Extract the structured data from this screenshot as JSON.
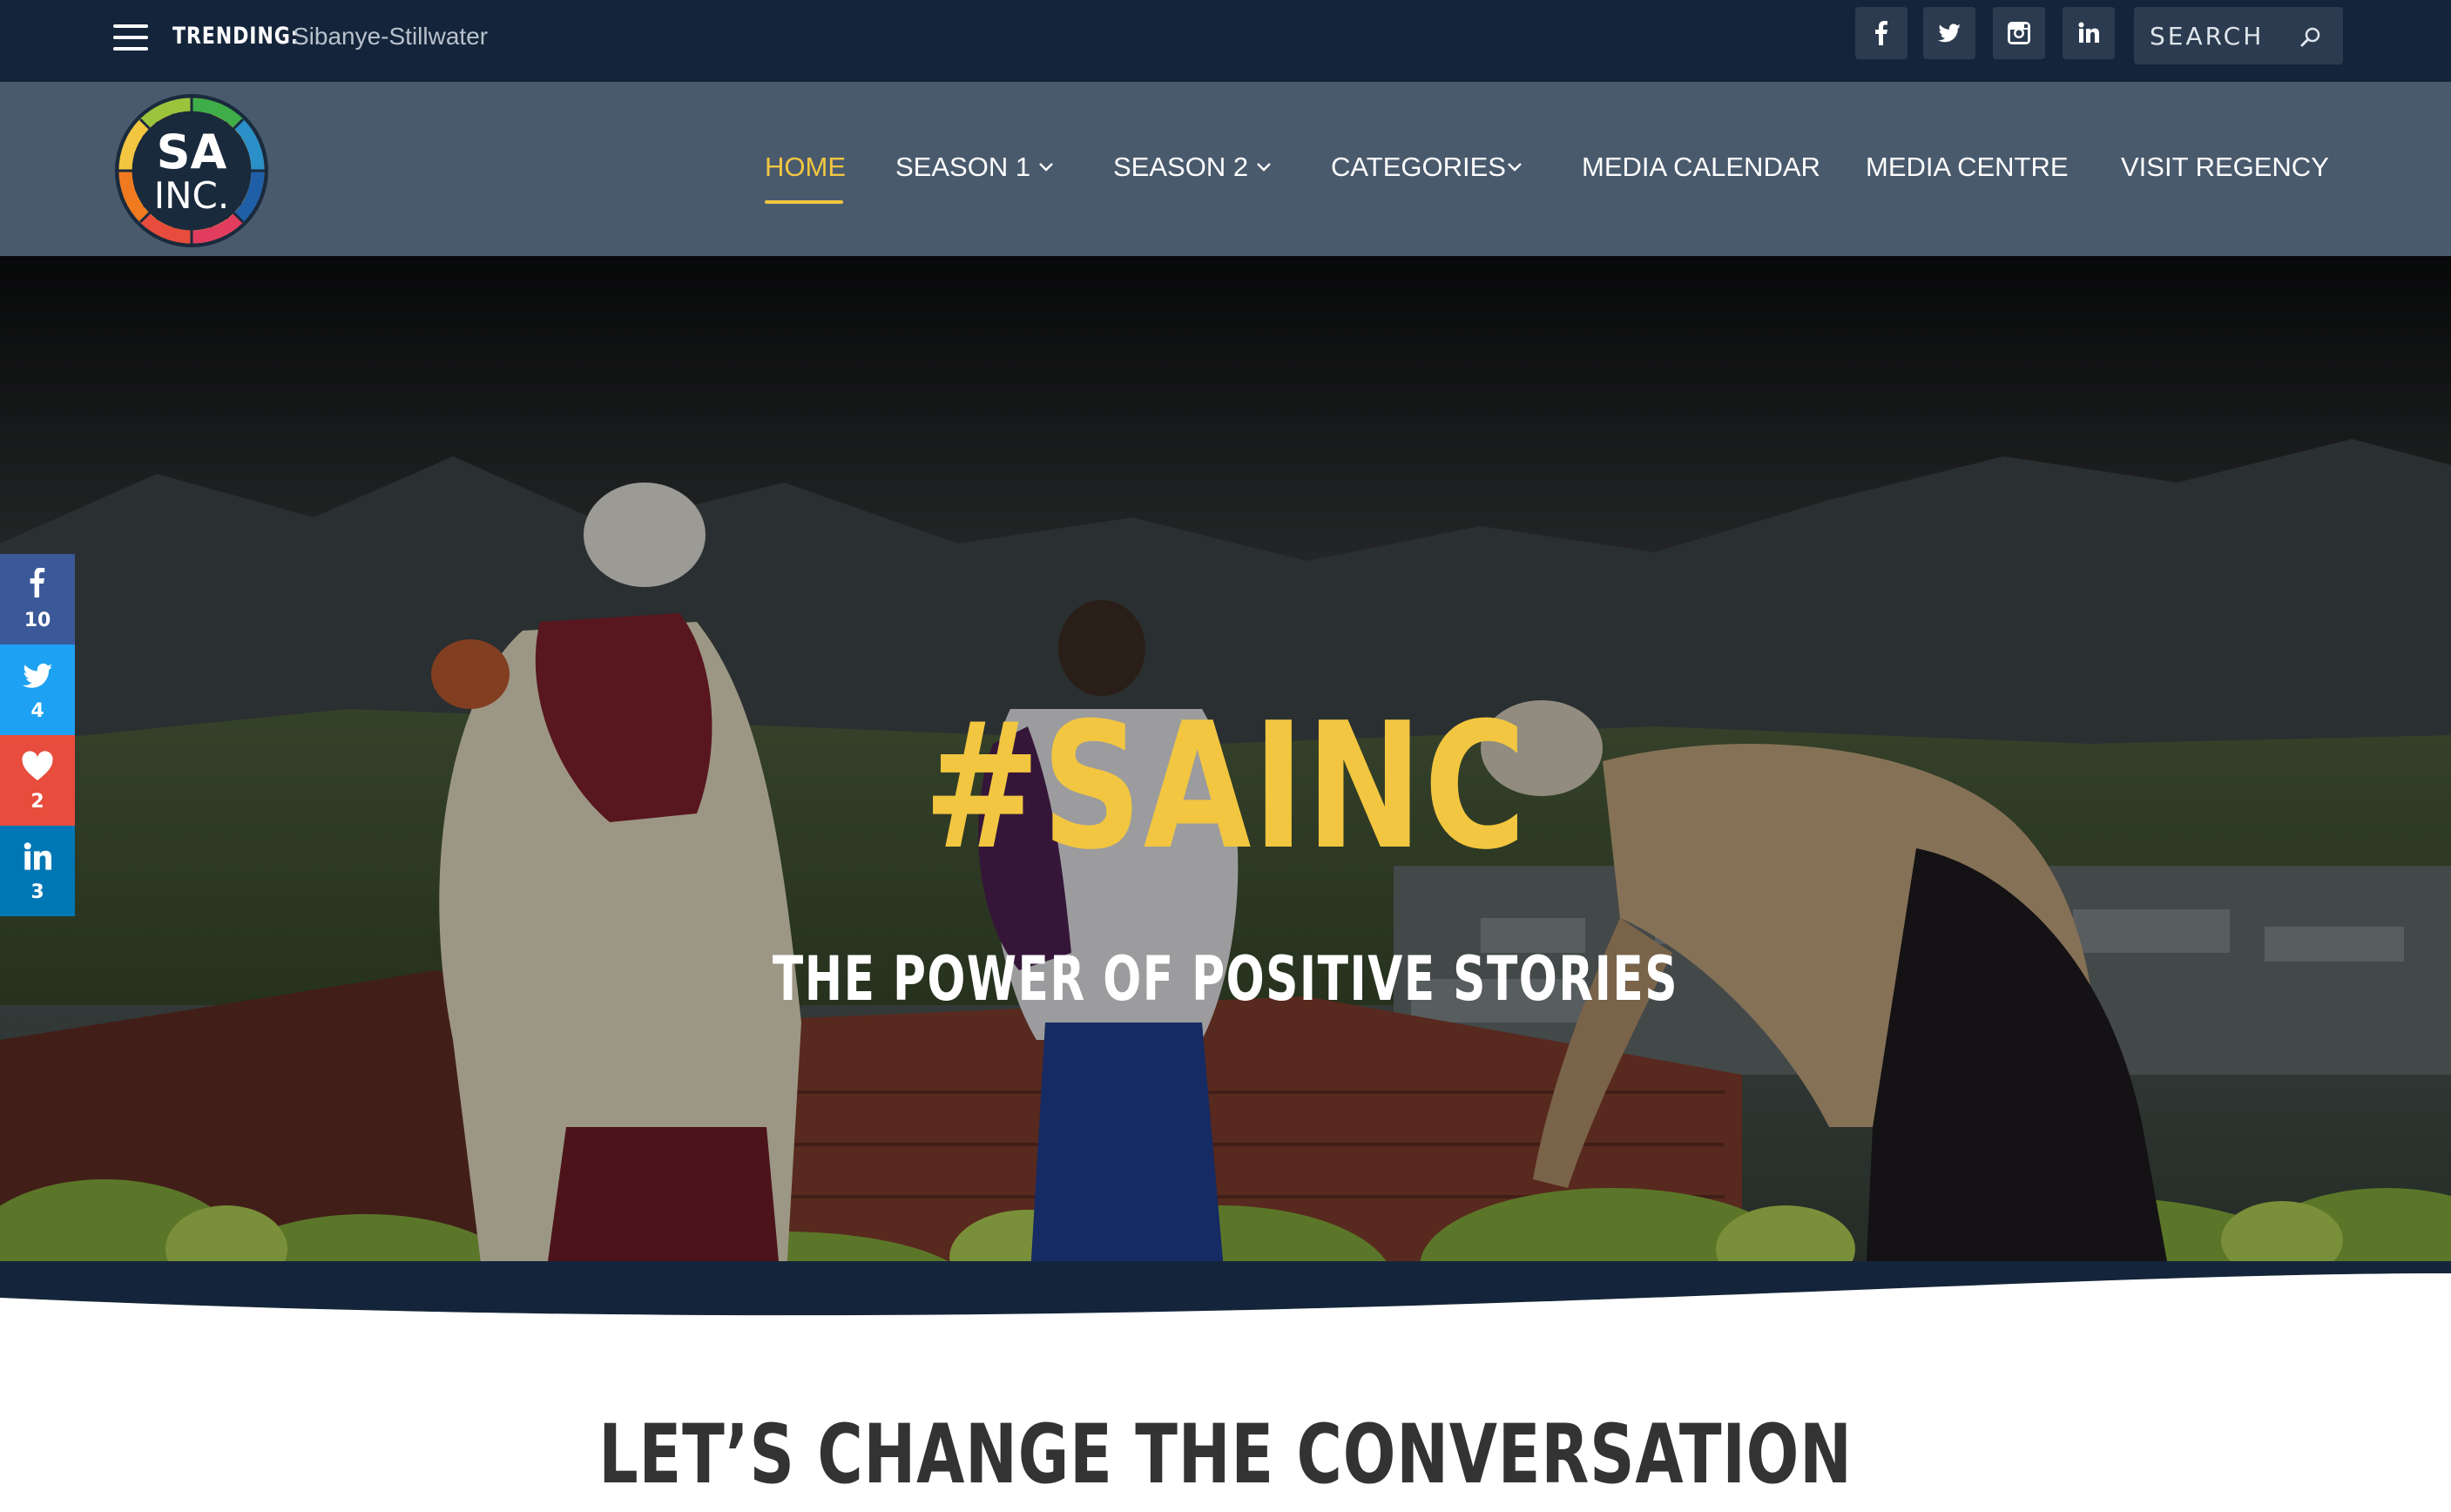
{
  "topbar": {
    "trending_label": "TRENDING:",
    "trending_value": "Sibanye-Stillwater",
    "social": [
      "facebook",
      "twitter",
      "instagram",
      "linkedin"
    ],
    "search_placeholder": "SEARCH"
  },
  "logo": {
    "line1": "SA",
    "line2": "INC."
  },
  "nav": {
    "items": [
      {
        "label": "HOME",
        "active": true
      },
      {
        "label": "SEASON 1",
        "has_dropdown": true
      },
      {
        "label": "SEASON 2",
        "has_dropdown": true
      },
      {
        "label": "CATEGORIES",
        "has_dropdown": true
      },
      {
        "label": "MEDIA CALENDAR"
      },
      {
        "label": "MEDIA CENTRE"
      },
      {
        "label": "VISIT REGENCY"
      }
    ]
  },
  "hero": {
    "title": "#SAINC",
    "subtitle": "THE POWER OF POSITIVE STORIES"
  },
  "share": [
    {
      "network": "facebook",
      "count": "10",
      "color": "#3b5998"
    },
    {
      "network": "twitter",
      "count": "4",
      "color": "#1da1f2"
    },
    {
      "network": "love",
      "count": "2",
      "color": "#e74c3c"
    },
    {
      "network": "linkedin",
      "count": "3",
      "color": "#0077b5"
    }
  ],
  "section": {
    "heading": "LET’S CHANGE THE CONVERSATION"
  },
  "colors": {
    "brand_dark": "#14253b",
    "nav_bg": "#4a5a6d",
    "accent_yellow": "#f2c640"
  }
}
